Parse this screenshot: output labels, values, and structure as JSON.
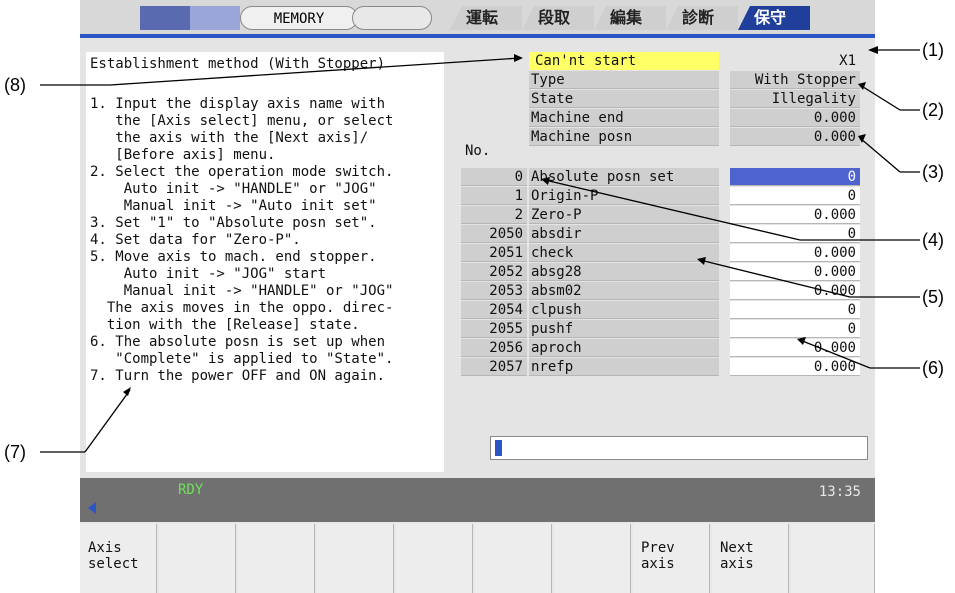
{
  "header": {
    "mode": "MEMORY",
    "tabs": [
      {
        "label": "運転",
        "active": false
      },
      {
        "label": "段取",
        "active": false
      },
      {
        "label": "編集",
        "active": false
      },
      {
        "label": "診断",
        "active": false
      },
      {
        "label": "保守",
        "active": true
      }
    ]
  },
  "guide": {
    "title": "Establishment method (With Stopper)",
    "lines": [
      "1. Input the display axis name with",
      "   the [Axis select] menu, or select",
      "   the axis with the [Next axis]/",
      "   [Before axis] menu.",
      "2. Select the operation mode switch.",
      "    Auto init -> \"HANDLE\" or \"JOG\"",
      "    Manual init -> \"Auto init set\"",
      "3. Set \"1\" to \"Absolute posn set\".",
      "4. Set data for \"Zero-P\".",
      "5. Move axis to mach. end stopper.",
      "    Auto init -> \"JOG\" start",
      "    Manual init -> \"HANDLE\" or \"JOG\"",
      "  The axis moves in the oppo. direc-",
      "  tion with the [Release] state.",
      "6. The absolute posn is set up when",
      "   \"Complete\" is applied to \"State\".",
      "7. Turn the power OFF and ON again."
    ]
  },
  "status_block": {
    "message": "Can'nt start",
    "axis": "X1",
    "rows": [
      {
        "label": "Type",
        "value": "With Stopper"
      },
      {
        "label": "State",
        "value": "Illegality"
      },
      {
        "label": "Machine end",
        "value": "0.000"
      },
      {
        "label": "Machine posn",
        "value": "0.000"
      }
    ]
  },
  "params": {
    "no_header": "No.",
    "rows": [
      {
        "no": "0",
        "name": "Absolute posn set",
        "value": "0"
      },
      {
        "no": "1",
        "name": "Origin-P",
        "value": "0"
      },
      {
        "no": "2",
        "name": "Zero-P",
        "value": "0.000"
      },
      {
        "no": "2050",
        "name": "absdir",
        "value": "0"
      },
      {
        "no": "2051",
        "name": "check",
        "value": "0.000"
      },
      {
        "no": "2052",
        "name": "absg28",
        "value": "0.000"
      },
      {
        "no": "2053",
        "name": "absm02",
        "value": "0.000"
      },
      {
        "no": "2054",
        "name": "clpush",
        "value": "0"
      },
      {
        "no": "2055",
        "name": "pushf",
        "value": "0"
      },
      {
        "no": "2056",
        "name": "aproch",
        "value": "0.000"
      },
      {
        "no": "2057",
        "name": "nrefp",
        "value": "0.000"
      }
    ]
  },
  "input": {
    "value": ""
  },
  "statusbar": {
    "state": "RDY",
    "time": "13:35"
  },
  "function_keys": [
    "Axis\nselect",
    "",
    "",
    "",
    "",
    "",
    "",
    "Prev\naxis",
    "Next\naxis",
    ""
  ],
  "callouts": [
    "(1)",
    "(2)",
    "(3)",
    "(4)",
    "(5)",
    "(6)",
    "(7)",
    "(8)"
  ],
  "colors": {
    "accent": "#2b54c4",
    "message_bg": "#ffff66",
    "ready": "#6fe05a"
  }
}
